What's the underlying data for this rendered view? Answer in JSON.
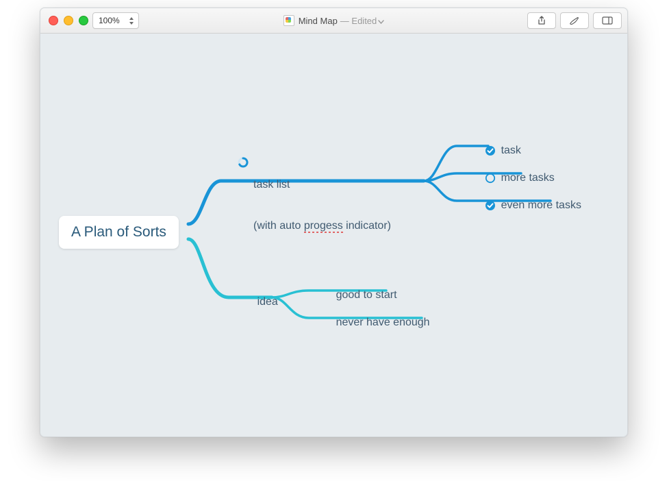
{
  "window": {
    "title": "Mind Map",
    "edited": "— Edited",
    "zoom": "100%"
  },
  "mindmap": {
    "root": "A Plan of Sorts",
    "branch_top": {
      "label_line1": "task list",
      "label_line2_pre": "(with auto ",
      "label_line2_spell": "progess",
      "label_line2_post": " indicator)",
      "items": [
        {
          "label": "task",
          "done": true
        },
        {
          "label": "more tasks",
          "done": false
        },
        {
          "label": "even more tasks",
          "done": true
        }
      ]
    },
    "branch_bottom": {
      "label": "idea",
      "items": [
        {
          "label": "good to start"
        },
        {
          "label": "never have enough"
        }
      ]
    }
  },
  "colors": {
    "blue": "#1994d7",
    "teal": "#29c0d3"
  }
}
